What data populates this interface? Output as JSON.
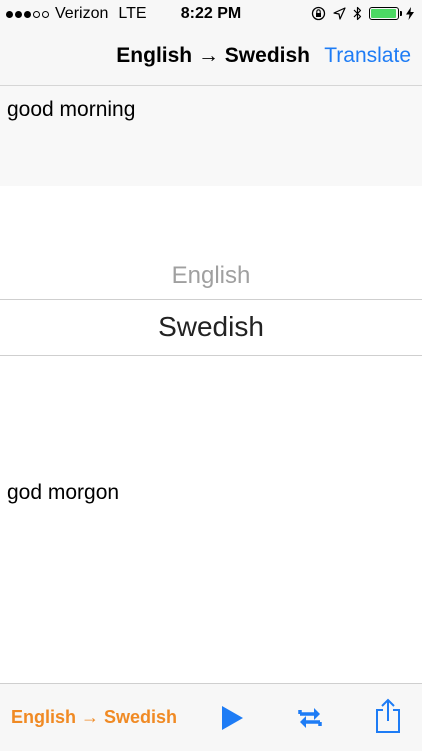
{
  "status_bar": {
    "carrier": "Verizon",
    "network": "LTE",
    "time": "8:22 PM",
    "signal_bars_filled": 3,
    "signal_bars_total": 5,
    "battery_level": 0.95,
    "battery_color": "#4cd964",
    "icons": [
      "orientation-lock-icon",
      "location-arrow-icon",
      "bluetooth-icon",
      "battery-icon",
      "charging-bolt-icon"
    ]
  },
  "nav_bar": {
    "title": "English → Swedish",
    "translate_label": "Translate",
    "accent_color": "#1e7cf5"
  },
  "input": {
    "text": "good morning"
  },
  "picker": {
    "faded_option": "English",
    "selected_option": "Swedish"
  },
  "output": {
    "text": "god morgon"
  },
  "toolbar": {
    "language_pair": "English → Swedish",
    "language_pair_color": "#f08a24",
    "icons": [
      "play-icon",
      "swap-icon",
      "share-icon"
    ],
    "icon_color": "#1e7cf5"
  }
}
